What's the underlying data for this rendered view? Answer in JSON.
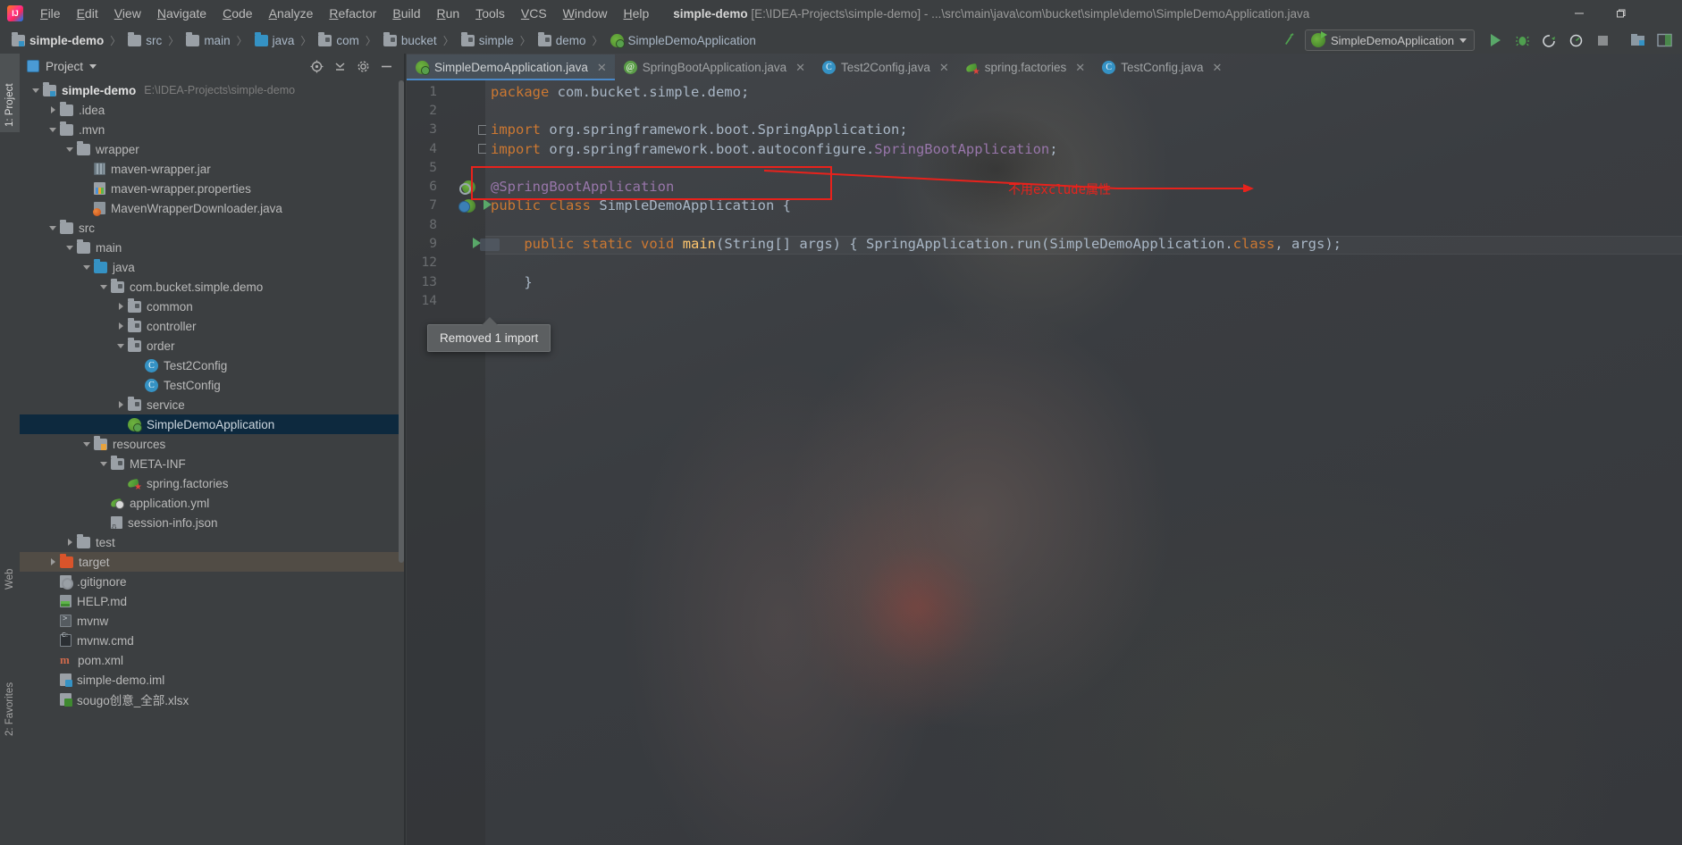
{
  "titlebar": {
    "logo_alt": "IntelliJ IDEA",
    "menus": [
      "File",
      "Edit",
      "View",
      "Navigate",
      "Code",
      "Analyze",
      "Refactor",
      "Build",
      "Run",
      "Tools",
      "VCS",
      "Window",
      "Help"
    ],
    "project_name": "simple-demo",
    "window_title_rest": "[E:\\IDEA-Projects\\simple-demo] - ...\\src\\main\\java\\com\\bucket\\simple\\demo\\SimpleDemoApplication.java",
    "minimize": "—",
    "maximize": "❐",
    "close": "✕"
  },
  "navbar": {
    "crumbs": [
      {
        "label": "simple-demo",
        "icon": "module-folder-icon",
        "sep": "〉"
      },
      {
        "label": "src",
        "icon": "folder-icon",
        "sep": "〉"
      },
      {
        "label": "main",
        "icon": "folder-icon",
        "sep": "〉"
      },
      {
        "label": "java",
        "icon": "source-folder-icon",
        "sep": "〉"
      },
      {
        "label": "com",
        "icon": "package-icon",
        "sep": "〉"
      },
      {
        "label": "bucket",
        "icon": "package-icon",
        "sep": "〉"
      },
      {
        "label": "simple",
        "icon": "package-icon",
        "sep": "〉"
      },
      {
        "label": "demo",
        "icon": "package-icon",
        "sep": "〉"
      },
      {
        "label": "SimpleDemoApplication",
        "icon": "spring-boot-class-icon",
        "sep": ""
      }
    ],
    "run_config": "SimpleDemoApplication",
    "toolbar_icons": [
      "build-icon",
      "run-icon",
      "debug-icon",
      "run-with-coverage-icon",
      "profile-icon",
      "stop-icon",
      "project-structure-icon",
      "terminal-icon"
    ]
  },
  "stripes": {
    "left_top": "1: Project",
    "left_mid": "Web",
    "left_bottom": "2: Favorites"
  },
  "project_panel": {
    "title": "Project",
    "header_icons": [
      "locate-icon",
      "collapse-all-icon",
      "settings-icon",
      "hide-icon"
    ],
    "tree": [
      {
        "depth": 0,
        "twist": "down",
        "icon": "module-folder-icon",
        "label": "simple-demo",
        "sub": "E:\\IDEA-Projects\\simple-demo",
        "root": true
      },
      {
        "depth": 1,
        "twist": "right",
        "icon": "folder-icon",
        "label": ".idea",
        "sub": ""
      },
      {
        "depth": 1,
        "twist": "down",
        "icon": "folder-icon",
        "label": ".mvn",
        "sub": ""
      },
      {
        "depth": 2,
        "twist": "down",
        "icon": "folder-icon",
        "label": "wrapper",
        "sub": ""
      },
      {
        "depth": 3,
        "twist": "none",
        "icon": "jar-icon",
        "label": "maven-wrapper.jar",
        "sub": ""
      },
      {
        "depth": 3,
        "twist": "none",
        "icon": "properties-icon",
        "label": "maven-wrapper.properties",
        "sub": ""
      },
      {
        "depth": 3,
        "twist": "none",
        "icon": "java-file-icon",
        "label": "MavenWrapperDownloader.java",
        "sub": ""
      },
      {
        "depth": 1,
        "twist": "down",
        "icon": "folder-icon",
        "label": "src",
        "sub": ""
      },
      {
        "depth": 2,
        "twist": "down",
        "icon": "folder-icon",
        "label": "main",
        "sub": ""
      },
      {
        "depth": 3,
        "twist": "down",
        "icon": "source-folder-icon",
        "label": "java",
        "sub": ""
      },
      {
        "depth": 4,
        "twist": "down",
        "icon": "package-icon",
        "label": "com.bucket.simple.demo",
        "sub": ""
      },
      {
        "depth": 5,
        "twist": "right",
        "icon": "package-icon",
        "label": "common",
        "sub": ""
      },
      {
        "depth": 5,
        "twist": "right",
        "icon": "package-icon",
        "label": "controller",
        "sub": ""
      },
      {
        "depth": 5,
        "twist": "down",
        "icon": "package-icon",
        "label": "order",
        "sub": ""
      },
      {
        "depth": 6,
        "twist": "none",
        "icon": "class-icon",
        "label": "Test2Config",
        "sub": ""
      },
      {
        "depth": 6,
        "twist": "none",
        "icon": "class-icon",
        "label": "TestConfig",
        "sub": ""
      },
      {
        "depth": 5,
        "twist": "right",
        "icon": "package-icon",
        "label": "service",
        "sub": ""
      },
      {
        "depth": 5,
        "twist": "none",
        "icon": "spring-boot-class-icon",
        "label": "SimpleDemoApplication",
        "sub": "",
        "selected": true
      },
      {
        "depth": 3,
        "twist": "down",
        "icon": "resources-folder-icon",
        "label": "resources",
        "sub": ""
      },
      {
        "depth": 4,
        "twist": "down",
        "icon": "package-icon",
        "label": "META-INF",
        "sub": ""
      },
      {
        "depth": 5,
        "twist": "none",
        "icon": "spring-factories-icon",
        "label": "spring.factories",
        "sub": ""
      },
      {
        "depth": 4,
        "twist": "none",
        "icon": "spring-yaml-icon",
        "label": "application.yml",
        "sub": ""
      },
      {
        "depth": 4,
        "twist": "none",
        "icon": "json-file-icon",
        "label": "session-info.json",
        "sub": ""
      },
      {
        "depth": 2,
        "twist": "right",
        "icon": "folder-icon",
        "label": "test",
        "sub": ""
      },
      {
        "depth": 1,
        "twist": "right",
        "icon": "excluded-folder-icon",
        "label": "target",
        "sub": "",
        "highlight": true
      },
      {
        "depth": 1,
        "twist": "none",
        "icon": "gitignore-icon",
        "label": ".gitignore",
        "sub": ""
      },
      {
        "depth": 1,
        "twist": "none",
        "icon": "markdown-icon",
        "label": "HELP.md",
        "sub": ""
      },
      {
        "depth": 1,
        "twist": "none",
        "icon": "shell-script-icon",
        "label": "mvnw",
        "sub": ""
      },
      {
        "depth": 1,
        "twist": "none",
        "icon": "cmd-script-icon",
        "label": "mvnw.cmd",
        "sub": ""
      },
      {
        "depth": 1,
        "twist": "none",
        "icon": "maven-pom-icon",
        "label": "pom.xml",
        "sub": ""
      },
      {
        "depth": 1,
        "twist": "none",
        "icon": "iml-module-icon",
        "label": "simple-demo.iml",
        "sub": ""
      },
      {
        "depth": 1,
        "twist": "none",
        "icon": "xlsx-icon",
        "label": "sougo创意_全部.xlsx",
        "sub": ""
      }
    ]
  },
  "editor": {
    "tabs": [
      {
        "label": "SimpleDemoApplication.java",
        "icon": "spring-boot-class-icon",
        "active": true,
        "close": "✕"
      },
      {
        "label": "SpringBootApplication.java",
        "icon": "annotation-class-icon",
        "active": false,
        "close": "✕"
      },
      {
        "label": "Test2Config.java",
        "icon": "class-icon",
        "active": false,
        "close": "✕"
      },
      {
        "label": "spring.factories",
        "icon": "spring-factories-icon",
        "active": false,
        "close": "✕"
      },
      {
        "label": "TestConfig.java",
        "icon": "class-icon",
        "active": false,
        "close": "✕"
      }
    ],
    "lines": [
      {
        "no": "1",
        "gutter": "",
        "segments": [
          {
            "t": "package",
            "c": "kw"
          },
          {
            "t": " com.bucket.simple.demo;",
            "c": "ident"
          }
        ]
      },
      {
        "no": "2",
        "gutter": "",
        "segments": []
      },
      {
        "no": "3",
        "gutter": "fold",
        "segments": [
          {
            "t": "import",
            "c": "kw"
          },
          {
            "t": " org.springframework.boot.",
            "c": "ident"
          },
          {
            "t": "SpringApplication",
            "c": "ident"
          },
          {
            "t": ";",
            "c": "ident"
          }
        ]
      },
      {
        "no": "4",
        "gutter": "fold-end",
        "segments": [
          {
            "t": "import",
            "c": "kw"
          },
          {
            "t": " org.springframework.boot.autoconfigure.",
            "c": "ident"
          },
          {
            "t": "SpringBootApplication",
            "c": "field"
          },
          {
            "t": ";",
            "c": "ident"
          }
        ]
      },
      {
        "no": "5",
        "gutter": "",
        "segments": []
      },
      {
        "no": "6",
        "gutter": "bean-q",
        "segments": [
          {
            "t": "@SpringBootApplication",
            "c": "field"
          }
        ]
      },
      {
        "no": "7",
        "gutter": "bean-run",
        "segments": [
          {
            "t": "public",
            "c": "kw"
          },
          {
            "t": " ",
            "c": "ident"
          },
          {
            "t": "class",
            "c": "kw"
          },
          {
            "t": " ",
            "c": "ident"
          },
          {
            "t": "SimpleDemoApplication",
            "c": "ident"
          },
          {
            "t": " {",
            "c": "ident"
          }
        ]
      },
      {
        "no": "8",
        "gutter": "",
        "segments": []
      },
      {
        "no": "9",
        "gutter": "run",
        "segments": [
          {
            "t": "    public",
            "c": "kw"
          },
          {
            "t": " ",
            "c": "ident"
          },
          {
            "t": "static",
            "c": "kw"
          },
          {
            "t": " ",
            "c": "ident"
          },
          {
            "t": "void",
            "c": "kw"
          },
          {
            "t": " ",
            "c": "ident"
          },
          {
            "t": "main",
            "c": "fn"
          },
          {
            "t": "(",
            "c": "ident"
          },
          {
            "t": "String",
            "c": "ident"
          },
          {
            "t": "[] args) { ",
            "c": "ident"
          },
          {
            "t": "SpringApplication",
            "c": "ident"
          },
          {
            "t": ".",
            "c": "ident"
          },
          {
            "t": "run",
            "c": "ident"
          },
          {
            "t": "(",
            "c": "ident"
          },
          {
            "t": "SimpleDemoApplication",
            "c": "ident"
          },
          {
            "t": ".",
            "c": "ident"
          },
          {
            "t": "class",
            "c": "kw"
          },
          {
            "t": ", args);",
            "c": "ident"
          }
        ]
      },
      {
        "no": "12",
        "gutter": "",
        "segments": []
      },
      {
        "no": "13",
        "gutter": "",
        "segments": [
          {
            "t": "    }",
            "c": "ident"
          }
        ]
      },
      {
        "no": "14",
        "gutter": "",
        "segments": []
      }
    ]
  },
  "annotation": {
    "text": "不用exclude属性",
    "color": "#e8221c"
  },
  "tooltip": {
    "text": "Removed 1 import"
  },
  "colors": {
    "accent_blue": "#4a88c7",
    "selection_blue": "#0d293e",
    "keyword_orange": "#cc7832",
    "annotation_purple": "#9876aa",
    "method_yellow": "#ffc66d",
    "ide_bg": "#3c3f41",
    "editor_text": "#a9b7c6"
  }
}
